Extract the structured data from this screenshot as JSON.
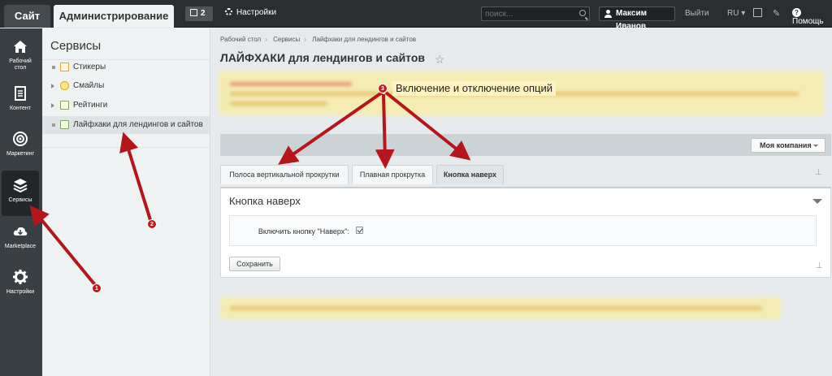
{
  "topbar": {
    "site_tab": "Сайт",
    "admin_tab": "Администрирование",
    "notifications_count": "2",
    "settings_label": "Настройки",
    "search_placeholder": "поиск...",
    "user_name": "Максим Иванов",
    "logout_label": "Выйти",
    "language": "RU",
    "help_label": "Помощь"
  },
  "leftnav": {
    "items": [
      {
        "label_line1": "Рабочий",
        "label_line2": "стол",
        "icon": "home-icon"
      },
      {
        "label_line1": "Контент",
        "label_line2": "",
        "icon": "document-icon"
      },
      {
        "label_line1": "Маркетинг",
        "label_line2": "",
        "icon": "target-icon"
      },
      {
        "label_line1": "Сервисы",
        "label_line2": "",
        "icon": "layers-icon",
        "active": true
      },
      {
        "label_line1": "Marketplace",
        "label_line2": "",
        "icon": "cloud-download-icon"
      },
      {
        "label_line1": "Настройки",
        "label_line2": "",
        "icon": "gear-icon"
      }
    ]
  },
  "sidebar": {
    "title": "Сервисы",
    "items": [
      {
        "label": "Стикеры"
      },
      {
        "label": "Смайлы"
      },
      {
        "label": "Рейтинги"
      },
      {
        "label": "Лайфхаки для лендингов и сайтов",
        "active": true
      }
    ]
  },
  "main": {
    "breadcrumb": [
      "Рабочий стол",
      "Сервисы",
      "Лайфхаки для лендингов и сайтов"
    ],
    "title": "ЛАЙФХАКИ для лендингов и сайтов",
    "company_selector": "Моя компания",
    "tabs": [
      {
        "label": "Полоса вертикальной прокрутки"
      },
      {
        "label": "Плавная прокрутка"
      },
      {
        "label": "Кнопка наверх",
        "active": true
      }
    ],
    "panel": {
      "title": "Кнопка наверх",
      "option_label": "Включить кнопку \"Наверх\":",
      "option_checked": true,
      "save_button": "Сохранить"
    }
  },
  "annotations": {
    "label_3": "Включение и отключение опций",
    "badge_1": "1",
    "badge_2": "2",
    "badge_3": "3",
    "color": "#b5161b"
  }
}
